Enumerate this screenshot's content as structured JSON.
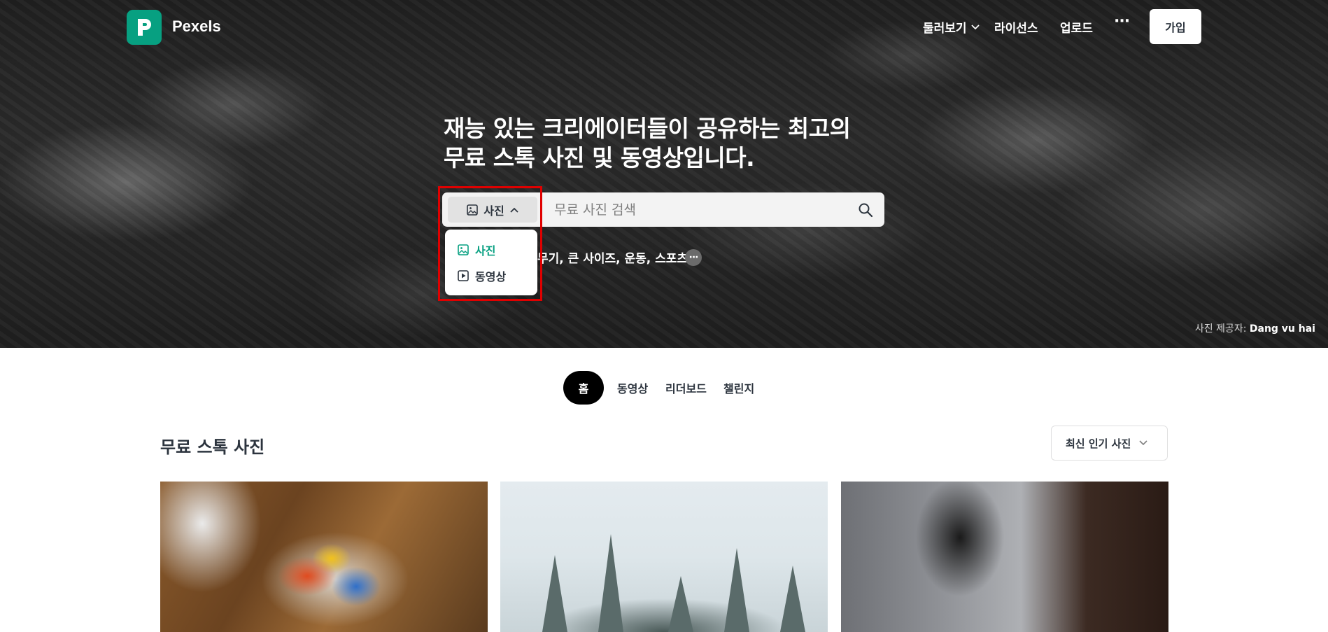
{
  "header": {
    "brand": "Pexels",
    "nav": {
      "explore": "둘러보기",
      "license": "라이선스",
      "upload": "업로드",
      "more": "···"
    },
    "join_label": "가입"
  },
  "hero": {
    "headline_line1": "재능 있는 크리에이터들이 공유하는 최고의",
    "headline_line2": "무료 스톡 사진 및 동영상입니다.",
    "search": {
      "type_selected": "사진",
      "placeholder": "무료 사진 검색"
    },
    "type_dropdown": {
      "options": [
        "사진",
        "동영상"
      ]
    },
    "suggestions_text": "무기, 큰 사이즈, 운동, 스포츠",
    "suggestions_more": "···",
    "credit_prefix": "사진 제공자:",
    "credit_name": "Dang vu hai"
  },
  "tabs": [
    "홈",
    "동영상",
    "리더보드",
    "챌린지"
  ],
  "section": {
    "title": "무료 스톡 사진",
    "sort_label": "최신 인기 사진"
  },
  "colors": {
    "brand": "#07a081",
    "highlight": "#e00000",
    "text": "#2c343e"
  }
}
